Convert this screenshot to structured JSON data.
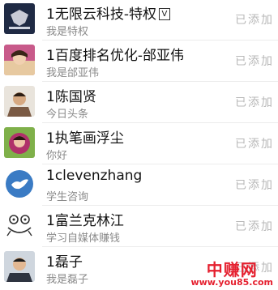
{
  "contacts": [
    {
      "name": "1无限云科技-特权",
      "subtitle": "我是特权",
      "action_label": "已添加",
      "verified_badge": "V",
      "avatar_icon": "company-logo-avatar",
      "avatar_color": "#1f2a44"
    },
    {
      "name": "1百度排名优化-邰亚伟",
      "subtitle": "我是邰亚伟",
      "action_label": "已添加",
      "avatar_icon": "portrait-avatar",
      "avatar_color": "#c85a8a"
    },
    {
      "name": "1陈国贤",
      "subtitle": "今日头条",
      "action_label": "已添加",
      "avatar_icon": "portrait-avatar",
      "avatar_color": "#7a5a44"
    },
    {
      "name": "1执笔画浮尘",
      "subtitle": "你好",
      "action_label": "已添加",
      "avatar_icon": "portrait-avatar",
      "avatar_color": "#b0306a"
    },
    {
      "name": "1clevenzhang",
      "subtitle": "学生咨询",
      "action_label": "已添加",
      "avatar_icon": "bird-logo-avatar",
      "avatar_color": "#3a7bc4"
    },
    {
      "name": "1富兰克林江",
      "subtitle": "学习自媒体赚钱",
      "action_label": "已添加",
      "avatar_icon": "cartoon-frog-avatar",
      "avatar_color": "#ffffff"
    },
    {
      "name": "1磊子",
      "subtitle": "我是磊子",
      "action_label": "已添加",
      "avatar_icon": "portrait-avatar",
      "avatar_color": "#5a6a7a"
    }
  ],
  "watermark": {
    "title": "中赚网",
    "url": "www.you85.com",
    "color": "#e5202f"
  }
}
